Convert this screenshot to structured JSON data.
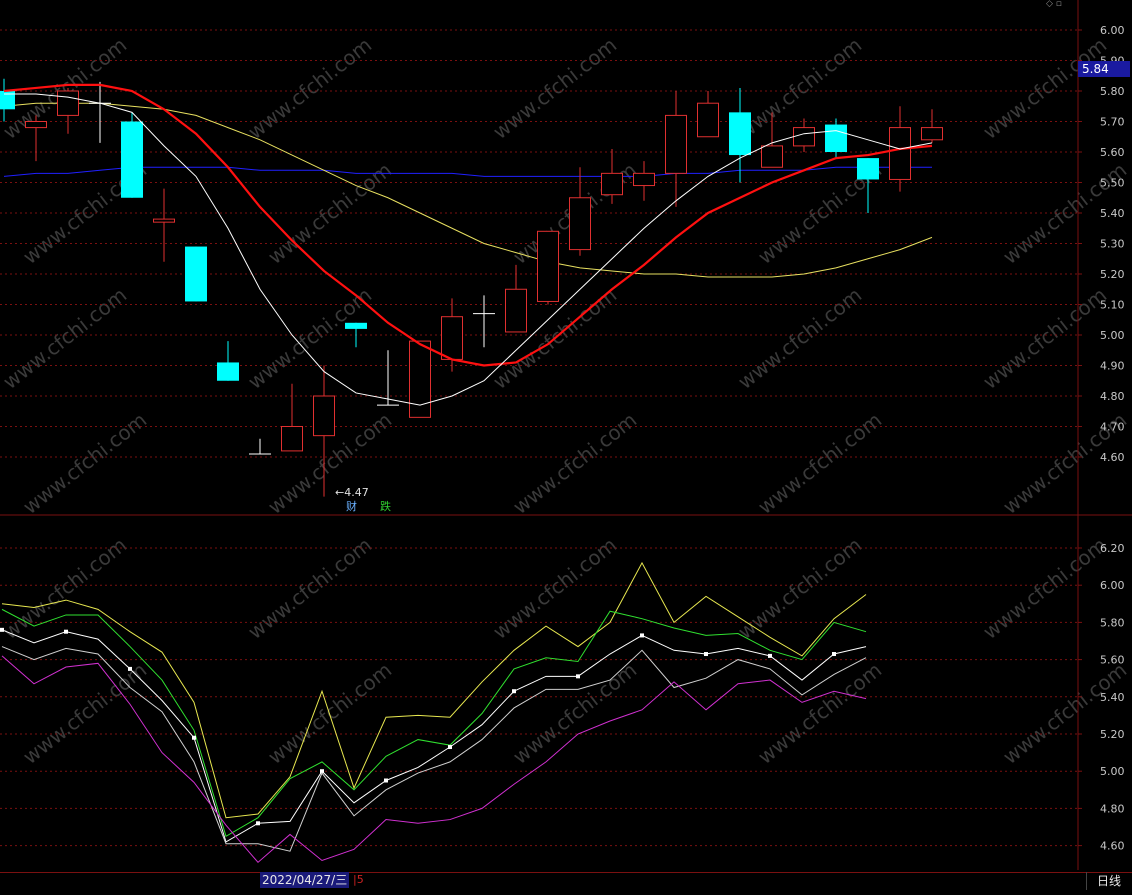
{
  "upper_axis_labels": [
    "6.00",
    "5.90",
    "5.80",
    "5.70",
    "5.60",
    "5.50",
    "5.40",
    "5.30",
    "5.20",
    "5.10",
    "5.00",
    "4.90",
    "4.80",
    "4.70",
    "4.60"
  ],
  "lower_axis_labels": [
    "6.20",
    "6.00",
    "5.80",
    "5.60",
    "5.40",
    "5.20",
    "5.00",
    "4.80",
    "4.60"
  ],
  "current_price": "5.84",
  "low_marker": "←4.47",
  "event_tags": {
    "cai": "财",
    "die": "跌"
  },
  "cursor_date": "2022/04/27/三",
  "cursor_extra": "|5",
  "period_button": "日线",
  "corner_icons": "◇ ▫",
  "watermark": "www.cfchi.com",
  "colors": {
    "background": "#000000",
    "grid": "#7a1010",
    "up_candle": "#e03030",
    "down_candle": "#00ffff",
    "ma5": "#ffffff",
    "ma10": "#ff1010",
    "ma20": "#e8e060",
    "ma60": "#2020ff"
  },
  "chart_data": [
    {
      "type": "candlestick",
      "ylim": [
        4.47,
        6.05
      ],
      "candles": [
        {
          "o": 5.74,
          "h": 5.84,
          "c": 5.8,
          "l": 5.7,
          "dir": "down"
        },
        {
          "o": 5.68,
          "h": 5.72,
          "c": 5.7,
          "l": 5.57,
          "dir": "up"
        },
        {
          "o": 5.72,
          "h": 5.81,
          "c": 5.8,
          "l": 5.66,
          "dir": "up"
        },
        {
          "o": 5.76,
          "h": 5.83,
          "c": 5.76,
          "l": 5.63,
          "dir": "doji"
        },
        {
          "o": 5.7,
          "h": 5.73,
          "c": 5.45,
          "l": 5.45,
          "dir": "down"
        },
        {
          "o": 5.37,
          "h": 5.48,
          "c": 5.38,
          "l": 5.24,
          "dir": "up"
        },
        {
          "o": 5.29,
          "h": 5.29,
          "c": 5.11,
          "l": 5.11,
          "dir": "down"
        },
        {
          "o": 4.91,
          "h": 4.98,
          "c": 4.85,
          "l": 4.85,
          "dir": "down"
        },
        {
          "o": 4.61,
          "h": 4.66,
          "c": 4.61,
          "l": 4.61,
          "dir": "doji"
        },
        {
          "o": 4.62,
          "h": 4.84,
          "c": 4.7,
          "l": 4.62,
          "dir": "up"
        },
        {
          "o": 4.67,
          "h": 4.9,
          "c": 4.8,
          "l": 4.47,
          "dir": "up"
        },
        {
          "o": 5.04,
          "h": 5.04,
          "c": 5.02,
          "l": 4.96,
          "dir": "down"
        },
        {
          "o": 4.77,
          "h": 4.95,
          "c": 4.77,
          "l": 4.77,
          "dir": "doji"
        },
        {
          "o": 4.73,
          "h": 4.98,
          "c": 4.98,
          "l": 4.73,
          "dir": "up"
        },
        {
          "o": 4.92,
          "h": 5.12,
          "c": 5.06,
          "l": 4.88,
          "dir": "up"
        },
        {
          "o": 5.07,
          "h": 5.13,
          "c": 5.07,
          "l": 4.96,
          "dir": "doji"
        },
        {
          "o": 5.01,
          "h": 5.23,
          "c": 5.15,
          "l": 5.01,
          "dir": "up"
        },
        {
          "o": 5.11,
          "h": 5.34,
          "c": 5.34,
          "l": 5.1,
          "dir": "up"
        },
        {
          "o": 5.28,
          "h": 5.55,
          "c": 5.45,
          "l": 5.26,
          "dir": "up"
        },
        {
          "o": 5.46,
          "h": 5.61,
          "c": 5.53,
          "l": 5.43,
          "dir": "up"
        },
        {
          "o": 5.49,
          "h": 5.57,
          "c": 5.53,
          "l": 5.44,
          "dir": "up"
        },
        {
          "o": 5.53,
          "h": 5.8,
          "c": 5.72,
          "l": 5.42,
          "dir": "up"
        },
        {
          "o": 5.65,
          "h": 5.8,
          "c": 5.76,
          "l": 5.65,
          "dir": "up"
        },
        {
          "o": 5.73,
          "h": 5.81,
          "c": 5.59,
          "l": 5.5,
          "dir": "down"
        },
        {
          "o": 5.55,
          "h": 5.73,
          "c": 5.62,
          "l": 5.55,
          "dir": "up"
        },
        {
          "o": 5.62,
          "h": 5.71,
          "c": 5.68,
          "l": 5.6,
          "dir": "up"
        },
        {
          "o": 5.69,
          "h": 5.71,
          "c": 5.6,
          "l": 5.58,
          "dir": "down"
        },
        {
          "o": 5.58,
          "h": 5.58,
          "c": 5.51,
          "l": 5.4,
          "dir": "down"
        },
        {
          "o": 5.51,
          "h": 5.75,
          "c": 5.68,
          "l": 5.47,
          "dir": "up"
        },
        {
          "o": 5.64,
          "h": 5.74,
          "c": 5.68,
          "l": 5.63,
          "dir": "up"
        }
      ],
      "ma5": [
        5.79,
        5.79,
        5.78,
        5.76,
        5.73,
        5.62,
        5.52,
        5.35,
        5.15,
        5.0,
        4.88,
        4.81,
        4.79,
        4.77,
        4.8,
        4.85,
        4.95,
        5.05,
        5.15,
        5.25,
        5.35,
        5.44,
        5.52,
        5.58,
        5.63,
        5.66,
        5.67,
        5.64,
        5.61,
        5.63
      ],
      "ma10": [
        5.8,
        5.81,
        5.82,
        5.82,
        5.8,
        5.74,
        5.66,
        5.55,
        5.42,
        5.31,
        5.21,
        5.13,
        5.04,
        4.97,
        4.92,
        4.9,
        4.91,
        4.97,
        5.06,
        5.15,
        5.23,
        5.32,
        5.4,
        5.45,
        5.5,
        5.54,
        5.58,
        5.59,
        5.61,
        5.62
      ],
      "ma20": [
        5.75,
        5.76,
        5.76,
        5.76,
        5.75,
        5.74,
        5.72,
        5.68,
        5.64,
        5.59,
        5.54,
        5.49,
        5.45,
        5.4,
        5.35,
        5.3,
        5.27,
        5.24,
        5.22,
        5.21,
        5.2,
        5.2,
        5.19,
        5.19,
        5.19,
        5.2,
        5.22,
        5.25,
        5.28,
        5.32
      ],
      "ma60": [
        5.52,
        5.53,
        5.53,
        5.54,
        5.55,
        5.55,
        5.55,
        5.55,
        5.54,
        5.54,
        5.54,
        5.53,
        5.53,
        5.53,
        5.53,
        5.52,
        5.52,
        5.52,
        5.52,
        5.52,
        5.52,
        5.53,
        5.53,
        5.54,
        5.54,
        5.54,
        5.55,
        5.55,
        5.55,
        5.55
      ]
    },
    {
      "type": "line",
      "ylim": [
        4.47,
        6.3
      ],
      "series": [
        {
          "color": "#e8e850",
          "values": [
            5.9,
            5.88,
            5.92,
            5.87,
            5.75,
            5.64,
            5.37,
            4.75,
            4.77,
            4.97,
            5.43,
            4.91,
            5.29,
            5.3,
            5.29,
            5.48,
            5.65,
            5.78,
            5.67,
            5.8,
            6.12,
            5.8,
            5.94,
            5.83,
            5.72,
            5.62,
            5.82,
            5.95
          ]
        },
        {
          "color": "#30e030",
          "values": [
            5.87,
            5.78,
            5.84,
            5.84,
            5.67,
            5.49,
            5.22,
            4.65,
            4.75,
            4.96,
            5.05,
            4.9,
            5.08,
            5.17,
            5.14,
            5.31,
            5.55,
            5.61,
            5.59,
            5.86,
            5.82,
            5.77,
            5.73,
            5.74,
            5.65,
            5.6,
            5.8,
            5.75
          ]
        },
        {
          "color": "#ffffff",
          "values": [
            5.76,
            5.69,
            5.75,
            5.71,
            5.55,
            5.38,
            5.18,
            4.62,
            4.72,
            4.73,
            5.0,
            4.83,
            4.95,
            5.02,
            5.13,
            5.25,
            5.43,
            5.51,
            5.51,
            5.63,
            5.73,
            5.65,
            5.63,
            5.66,
            5.62,
            5.49,
            5.63,
            5.67
          ]
        },
        {
          "color": "#d0d0d0",
          "values": [
            5.67,
            5.6,
            5.66,
            5.63,
            5.45,
            5.32,
            5.05,
            4.61,
            4.61,
            4.57,
            4.99,
            4.76,
            4.9,
            4.99,
            5.05,
            5.17,
            5.34,
            5.44,
            5.44,
            5.49,
            5.65,
            5.45,
            5.5,
            5.6,
            5.55,
            5.41,
            5.52,
            5.61
          ]
        },
        {
          "color": "#d030d0",
          "values": [
            5.62,
            5.47,
            5.56,
            5.58,
            5.36,
            5.1,
            4.94,
            4.71,
            4.51,
            4.66,
            4.52,
            4.58,
            4.74,
            4.72,
            4.74,
            4.8,
            4.93,
            5.05,
            5.2,
            5.27,
            5.33,
            5.48,
            5.33,
            5.47,
            5.49,
            5.37,
            5.43,
            5.39
          ]
        }
      ]
    }
  ]
}
